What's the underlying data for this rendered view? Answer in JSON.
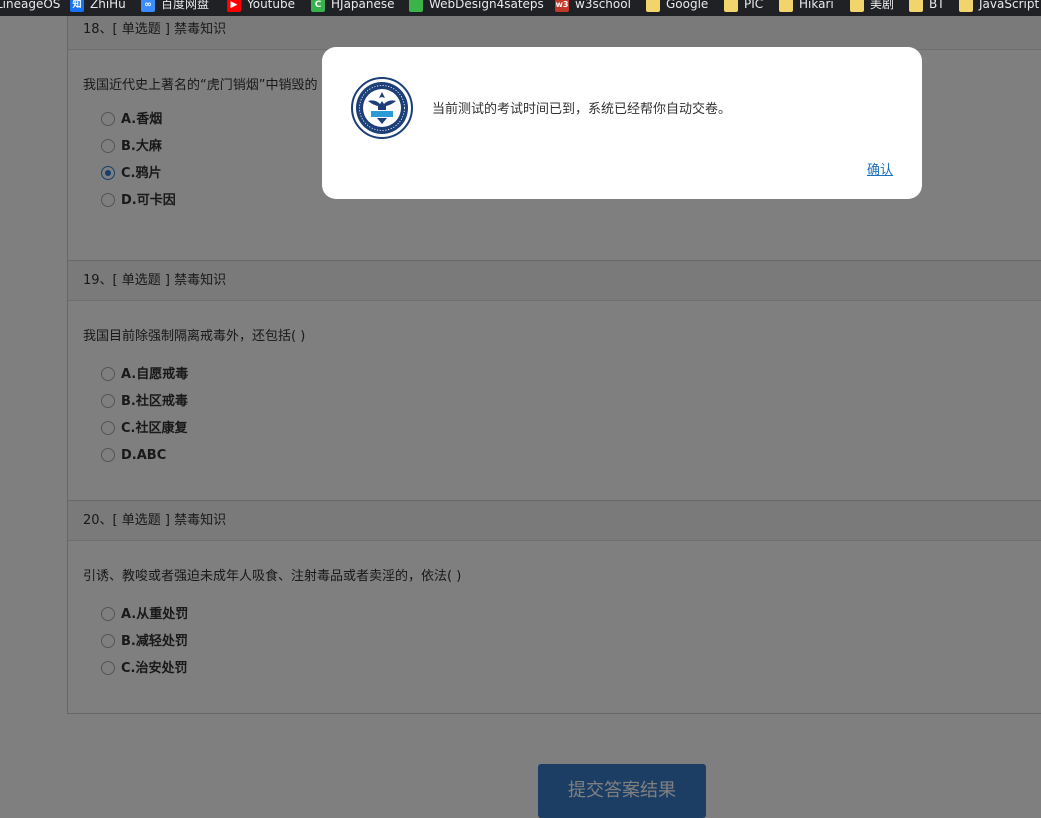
{
  "bookmarks": [
    {
      "label": "LineageOS",
      "icon": "none"
    },
    {
      "label": "ZhiHu",
      "icon": "zhihu-icon",
      "glyph": "知",
      "color": "#1772f6"
    },
    {
      "label": "百度网盘",
      "icon": "baidu-pan-icon",
      "glyph": "∞",
      "color": "#3b8cff"
    },
    {
      "label": "Youtube",
      "icon": "youtube-icon",
      "glyph": "▶",
      "color": "#ff0000"
    },
    {
      "label": "HJapanese",
      "icon": "hjapanese-icon",
      "glyph": "C",
      "color": "#37b24d"
    },
    {
      "label": "WebDesign4sateps",
      "icon": "webdesign-icon",
      "glyph": "",
      "color": "#3bb54a"
    },
    {
      "label": "w3school",
      "icon": "w3school-icon",
      "glyph": "w3",
      "color": "#c0392b"
    },
    {
      "label": "Google",
      "icon": "folder-icon"
    },
    {
      "label": "PIC",
      "icon": "folder-icon"
    },
    {
      "label": "Hikari",
      "icon": "folder-icon"
    },
    {
      "label": "美剧",
      "icon": "folder-icon"
    },
    {
      "label": "BT",
      "icon": "folder-icon"
    },
    {
      "label": "JavaScript",
      "icon": "folder-icon"
    }
  ],
  "questions": [
    {
      "header": "18、[ 单选题 ] 禁毒知识",
      "text": "我国近代史上著名的“虎门销烟”中销毁的",
      "options": [
        {
          "label": "A.香烟",
          "checked": false
        },
        {
          "label": "B.大麻",
          "checked": false
        },
        {
          "label": "C.鸦片",
          "checked": true
        },
        {
          "label": "D.可卡因",
          "checked": false
        }
      ]
    },
    {
      "header": "19、[ 单选题 ] 禁毒知识",
      "text": "我国目前除强制隔离戒毒外，还包括( )",
      "options": [
        {
          "label": "A.自愿戒毒",
          "checked": false
        },
        {
          "label": "B.社区戒毒",
          "checked": false
        },
        {
          "label": "C.社区康复",
          "checked": false
        },
        {
          "label": "D.ABC",
          "checked": false
        }
      ]
    },
    {
      "header": "20、[ 单选题 ] 禁毒知识",
      "text": "引诱、教唆或者强迫未成年人吸食、注射毒品或者卖淫的，依法( )",
      "options": [
        {
          "label": "A.从重处罚",
          "checked": false
        },
        {
          "label": "B.减轻处罚",
          "checked": false
        },
        {
          "label": "C.治安处罚",
          "checked": false
        }
      ]
    }
  ],
  "submit_label": "提交答案结果",
  "dialog": {
    "logo_icon": "national-narcotics-control-emblem-icon",
    "message": "当前测试的考试时间已到，系统已经帮你自动交卷。",
    "confirm_label": "确认"
  },
  "colors": {
    "accent": "#3a7dc9",
    "link": "#1a6fbf",
    "overlay": "rgba(0,0,0,0.5)"
  }
}
